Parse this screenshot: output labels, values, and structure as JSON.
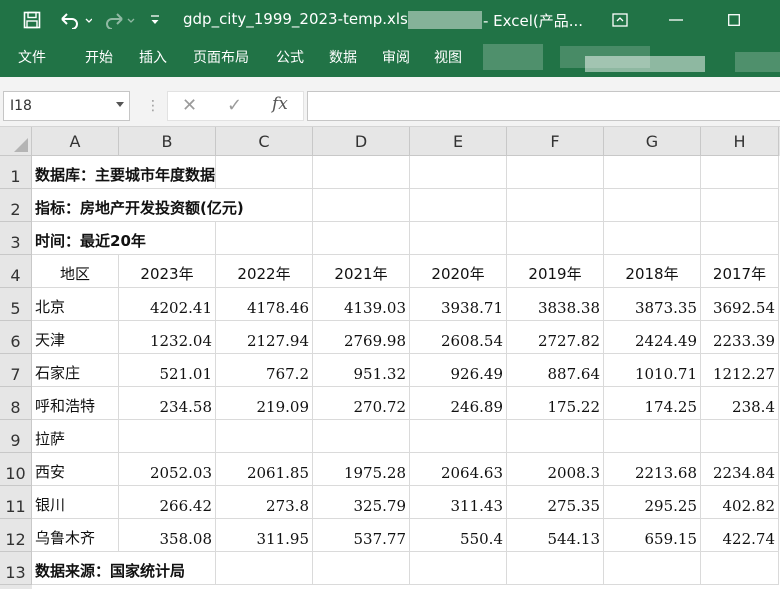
{
  "window": {
    "document_title": "gdp_city_1999_2023-temp.xls",
    "app_title": "- Excel(产品...",
    "save_icon": "save-icon",
    "undo_icon": "undo-icon",
    "redo_icon": "redo-icon",
    "customize_icon": "customize-qat-icon",
    "ribbon_display_icon": "ribbon-display-options-icon",
    "minimize_icon": "minimize-icon",
    "maximize_icon": "maximize-icon",
    "theme_color": "#217346"
  },
  "ribbon": {
    "tabs": [
      "文件",
      "开始",
      "插入",
      "页面布局",
      "公式",
      "数据",
      "审阅",
      "视图"
    ]
  },
  "formula_bar": {
    "name_box": "I18",
    "cancel": "✕",
    "enter": "✓",
    "fx": "fx",
    "formula": ""
  },
  "sheet": {
    "columns": [
      "A",
      "B",
      "C",
      "D",
      "E",
      "F",
      "G",
      "H"
    ],
    "rows": [
      "1",
      "2",
      "3",
      "4",
      "5",
      "6",
      "7",
      "8",
      "9",
      "10",
      "11",
      "12",
      "13"
    ],
    "title_cells": {
      "database": "数据库：主要城市年度数据",
      "indicator": "指标：房地产开发投资额(亿元)",
      "time": "时间：最近20年",
      "source": "数据来源：国家统计局"
    },
    "header_row": [
      "地区",
      "2023年",
      "2022年",
      "2021年",
      "2020年",
      "2019年",
      "2018年",
      "2017年"
    ],
    "data_rows": [
      [
        "北京",
        "4202.41",
        "4178.46",
        "4139.03",
        "3938.71",
        "3838.38",
        "3873.35",
        "3692.54"
      ],
      [
        "天津",
        "1232.04",
        "2127.94",
        "2769.98",
        "2608.54",
        "2727.82",
        "2424.49",
        "2233.39"
      ],
      [
        "石家庄",
        "521.01",
        "767.2",
        "951.32",
        "926.49",
        "887.64",
        "1010.71",
        "1212.27"
      ],
      [
        "呼和浩特",
        "234.58",
        "219.09",
        "270.72",
        "246.89",
        "175.22",
        "174.25",
        "238.4"
      ],
      [
        "拉萨",
        "",
        "",
        "",
        "",
        "",
        "",
        ""
      ],
      [
        "西安",
        "2052.03",
        "2061.85",
        "1975.28",
        "2064.63",
        "2008.3",
        "2213.68",
        "2234.84"
      ],
      [
        "银川",
        "266.42",
        "273.8",
        "325.79",
        "311.43",
        "275.35",
        "295.25",
        "402.82"
      ],
      [
        "乌鲁木齐",
        "358.08",
        "311.95",
        "537.77",
        "550.4",
        "544.13",
        "659.15",
        "422.74"
      ]
    ]
  }
}
